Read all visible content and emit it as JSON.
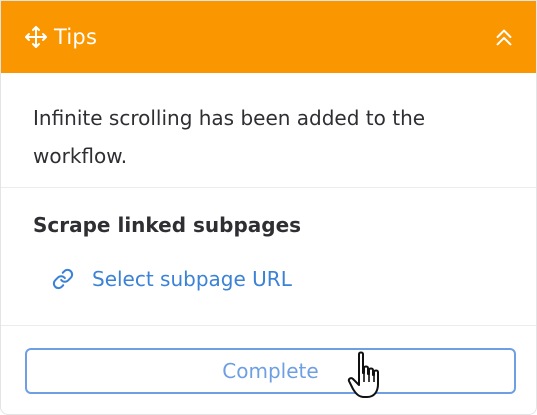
{
  "header": {
    "title": "Tips",
    "background_color": "#fa9600",
    "move_icon": "move-arrows-icon",
    "collapse_icon": "chevrons-up-icon"
  },
  "message": {
    "text": "Infinite scrolling has been added to the workflow."
  },
  "subpages": {
    "title": "Scrape linked subpages",
    "link_label": "Select subpage URL",
    "link_icon": "link-icon",
    "link_color": "#3b82d6"
  },
  "actions": {
    "complete_label": "Complete",
    "complete_color": "#6f9fe3"
  },
  "cursor": {
    "type": "hand-pointer-icon"
  }
}
